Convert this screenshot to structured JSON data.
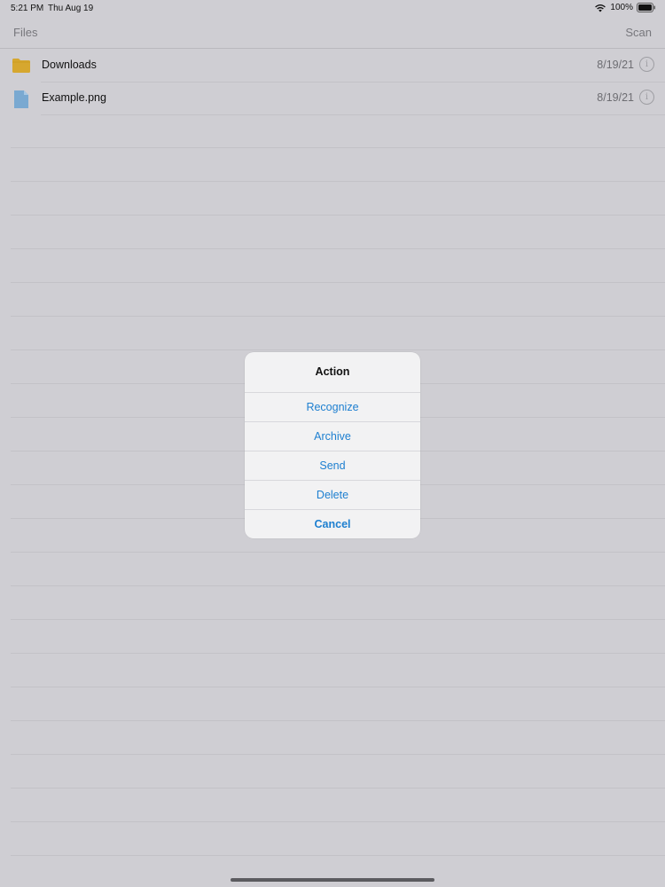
{
  "status_bar": {
    "time": "5:21 PM",
    "date": "Thu Aug 19",
    "battery": "100%",
    "icons": [
      "wifi-icon",
      "battery-icon"
    ]
  },
  "nav_bar": {
    "left_label": "Files",
    "right_label": "Scan"
  },
  "files": [
    {
      "name": "Downloads",
      "date": "8/19/21",
      "icon": "folder-icon",
      "color": "#d6a72f"
    },
    {
      "name": "Example.png",
      "date": "8/19/21",
      "icon": "image-file-icon",
      "color": "#7aa9d1"
    }
  ],
  "dialog": {
    "title": "Action",
    "actions": [
      "Recognize",
      "Archive",
      "Send",
      "Delete"
    ],
    "cancel": "Cancel",
    "accent_color": "#1d7fd0"
  }
}
